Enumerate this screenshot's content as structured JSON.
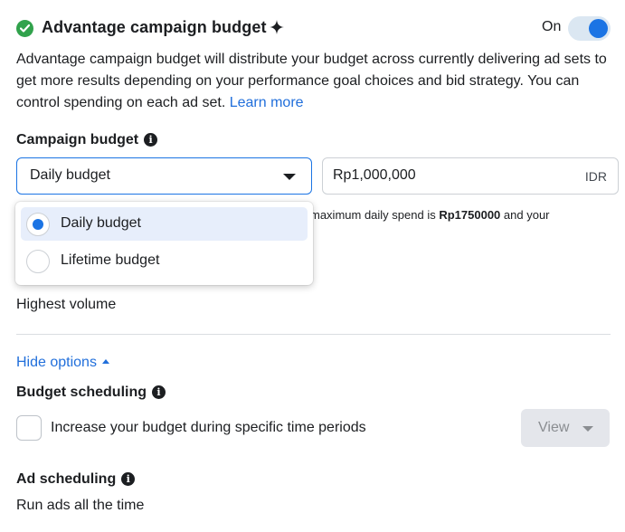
{
  "header": {
    "title": "Advantage campaign budget",
    "toggle_label": "On",
    "toggle_on": true
  },
  "description": {
    "text": "Advantage campaign budget will distribute your budget across currently delivering ad sets to get more results depending on your performance goal choices and bid strategy. You can control spending on each ad set.",
    "link": "Learn more"
  },
  "campaign_budget": {
    "label": "Campaign budget",
    "info_glyph": "i",
    "selected_type": "Daily budget",
    "amount": "Rp1,000,000",
    "currency": "IDR",
    "hint_prefix": "maximum daily spend is",
    "hint_max": "Rp1750000",
    "hint_suffix": "and your"
  },
  "budget_type_dropdown": {
    "options": [
      {
        "label": "Daily budget",
        "selected": true
      },
      {
        "label": "Lifetime budget",
        "selected": false
      }
    ]
  },
  "bid_strategy": {
    "value": "Highest volume"
  },
  "hide_options": {
    "label": "Hide options"
  },
  "budget_scheduling": {
    "label": "Budget scheduling",
    "info_glyph": "i",
    "checkbox_label": "Increase your budget during specific time periods",
    "checked": false,
    "view_button": "View"
  },
  "ad_scheduling": {
    "label": "Ad scheduling",
    "info_glyph": "i",
    "value": "Run ads all the time"
  },
  "colors": {
    "accent": "#1b74e4",
    "link": "#216fdb",
    "success": "#31a24c",
    "selected_bg": "#e7eefb"
  }
}
